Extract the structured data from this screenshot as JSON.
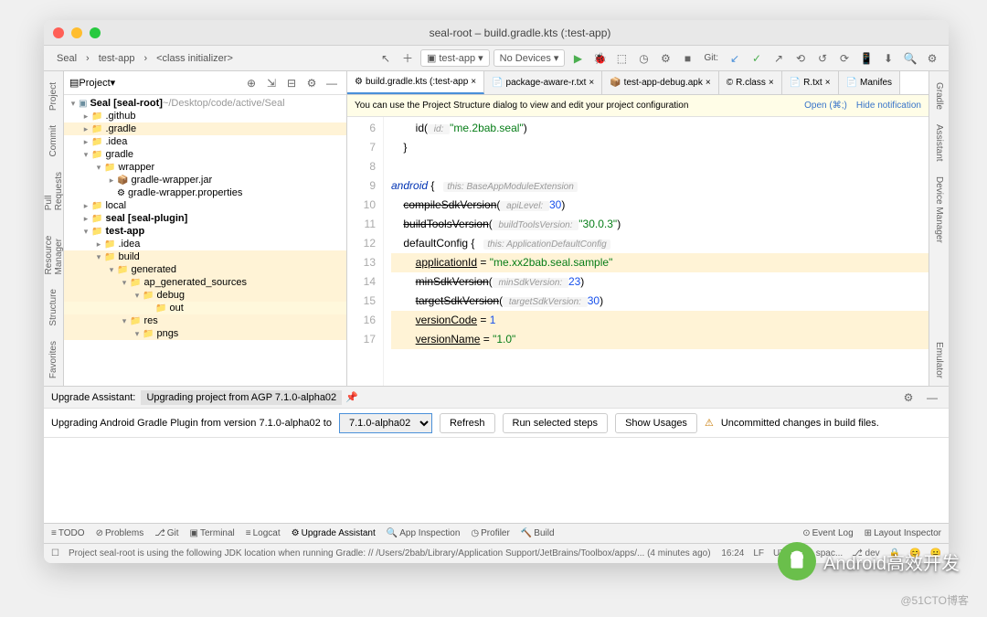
{
  "titlebar": {
    "title": "seal-root – build.gradle.kts (:test-app)"
  },
  "breadcrumb": {
    "p1": "Seal",
    "p2": "test-app",
    "p3": "<class initializer>"
  },
  "run": {
    "config": "test-app",
    "devices": "No Devices",
    "vcs": "Git:"
  },
  "sidebar": {
    "view": "Project",
    "root": "Seal [seal-root]",
    "root_path": "~/Desktop/code/active/Seal",
    "items": [
      ".github",
      ".gradle",
      ".idea",
      "gradle",
      "wrapper",
      "gradle-wrapper.jar",
      "gradle-wrapper.properties",
      "local",
      "seal [seal-plugin]",
      "test-app",
      ".idea",
      "build",
      "generated",
      "ap_generated_sources",
      "debug",
      "out",
      "res",
      "pngs"
    ]
  },
  "left_rail": [
    "Project",
    "Commit",
    "Pull Requests",
    "Resource Manager",
    "Structure",
    "Favorites"
  ],
  "right_rail": [
    "Gradle",
    "Assistant",
    "Device Manager",
    "Emulator"
  ],
  "tabs": [
    {
      "label": "build.gradle.kts (:test-app",
      "active": true
    },
    {
      "label": "package-aware-r.txt"
    },
    {
      "label": "test-app-debug.apk"
    },
    {
      "label": "R.class"
    },
    {
      "label": "R.txt"
    },
    {
      "label": "Manifes"
    }
  ],
  "notice": {
    "msg": "You can use the Project Structure dialog to view and edit your project configuration",
    "open": "Open (⌘;)",
    "hide": "Hide notification"
  },
  "code": {
    "lines": [
      "6",
      "7",
      "8",
      "9",
      "10",
      "11",
      "12",
      "13",
      "14",
      "15",
      "16",
      "17"
    ],
    "l6_a": "        id(",
    "l6_p": " id: ",
    "l6_s": "\"me.2bab.seal\"",
    "l6_e": ")",
    "l7": "    }",
    "l9_a": "android",
    "l9_b": " {   ",
    "l9_h": "this: BaseAppModuleExtension",
    "l10_a": "    ",
    "l10_s": "compileSdkVersion",
    "l10_b": "(",
    "l10_p": " apiLevel: ",
    "l10_n": "30",
    "l10_e": ")",
    "l11_a": "    ",
    "l11_s": "buildToolsVersion",
    "l11_b": "(",
    "l11_p": " buildToolsVersion: ",
    "l11_v": "\"30.0.3\"",
    "l11_e": ")",
    "l12_a": "    defaultConfig {   ",
    "l12_h": "this: ApplicationDefaultConfig",
    "l13_a": "        ",
    "l13_u": "applicationId",
    "l13_b": " = ",
    "l13_s": "\"me.xx2bab.seal.sample\"",
    "l14_a": "        ",
    "l14_s": "minSdkVersion",
    "l14_b": "(",
    "l14_p": " minSdkVersion: ",
    "l14_n": "23",
    "l14_e": ")",
    "l15_a": "        ",
    "l15_s": "targetSdkVersion",
    "l15_b": "(",
    "l15_p": " targetSdkVersion: ",
    "l15_n": "30",
    "l15_e": ")",
    "l16_a": "        ",
    "l16_u": "versionCode",
    "l16_b": " = ",
    "l16_n": "1",
    "l17_a": "        ",
    "l17_u": "versionName",
    "l17_b": " = ",
    "l17_s": "\"1.0\""
  },
  "panel": {
    "title": "Upgrade Assistant:",
    "subtitle": "Upgrading project from AGP 7.1.0-alpha02",
    "msg": "Upgrading Android Gradle Plugin from version 7.1.0-alpha02 to",
    "version": "7.1.0-alpha02",
    "refresh": "Refresh",
    "run": "Run selected steps",
    "usages": "Show Usages",
    "warn": "Uncommitted changes in build files."
  },
  "bottom_tabs": [
    "TODO",
    "Problems",
    "Git",
    "Terminal",
    "Logcat",
    "Upgrade Assistant",
    "App Inspection",
    "Profiler",
    "Build"
  ],
  "bottom_right": {
    "event": "Event Log",
    "layout": "Layout Inspector"
  },
  "status": {
    "msg": "Project seal-root is using the following JDK location when running Gradle: // /Users/2bab/Library/Application Support/JetBrains/Toolbox/apps/... (4 minutes ago)",
    "pos": "16:24",
    "lf": "LF",
    "enc": "UTF-8",
    "indent": "4 spac...",
    "branch": "dev"
  },
  "watermark": {
    "text": "Android高效开发",
    "credit": "@51CTO博客"
  }
}
